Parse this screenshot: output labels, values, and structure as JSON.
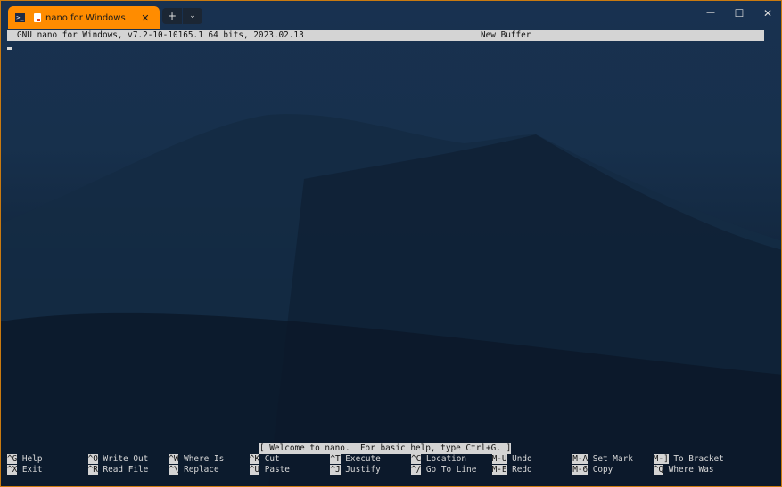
{
  "tab": {
    "title": "nano for Windows",
    "close": "✕"
  },
  "tabbar": {
    "new_tab": "+",
    "dropdown": "⌄"
  },
  "window_controls": {
    "minimize": "—",
    "maximize": "☐",
    "close": "✕"
  },
  "nano": {
    "header_version": "GNU nano for Windows, v7.2-10-10165.1 64 bits, 2023.02.13",
    "header_buffer": "New Buffer",
    "status": "[ Welcome to nano.  For basic help, type Ctrl+G. ]",
    "shortcuts": [
      [
        {
          "key": "^G",
          "label": "Help"
        },
        {
          "key": "^X",
          "label": "Exit"
        }
      ],
      [
        {
          "key": "^O",
          "label": "Write Out"
        },
        {
          "key": "^R",
          "label": "Read File"
        }
      ],
      [
        {
          "key": "^W",
          "label": "Where Is"
        },
        {
          "key": "^\\",
          "label": "Replace"
        }
      ],
      [
        {
          "key": "^K",
          "label": "Cut"
        },
        {
          "key": "^U",
          "label": "Paste"
        }
      ],
      [
        {
          "key": "^T",
          "label": "Execute"
        },
        {
          "key": "^J",
          "label": "Justify"
        }
      ],
      [
        {
          "key": "^C",
          "label": "Location"
        },
        {
          "key": "^/",
          "label": "Go To Line"
        }
      ],
      [
        {
          "key": "M-U",
          "label": "Undo"
        },
        {
          "key": "M-E",
          "label": "Redo"
        }
      ],
      [
        {
          "key": "M-A",
          "label": "Set Mark"
        },
        {
          "key": "M-6",
          "label": "Copy"
        }
      ],
      [
        {
          "key": "M-]",
          "label": "To Bracket"
        },
        {
          "key": "^Q",
          "label": "Where Was"
        }
      ]
    ]
  },
  "colors": {
    "accent": "#ff8c00",
    "bar": "#d4d4d4"
  }
}
